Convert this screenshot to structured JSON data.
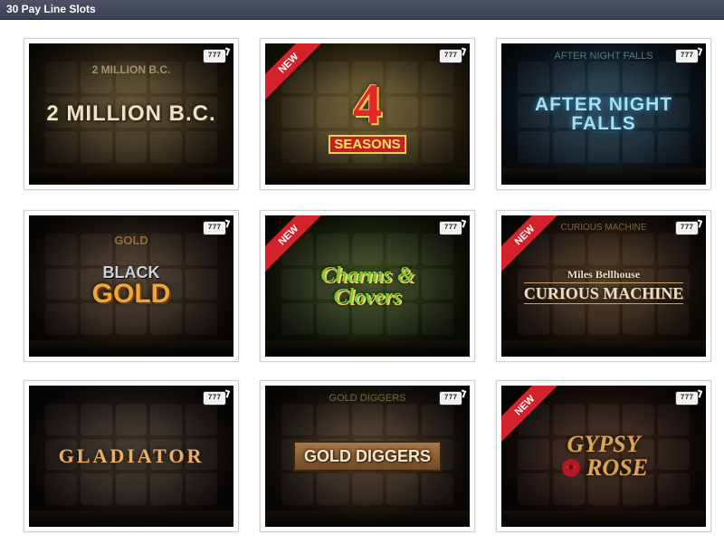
{
  "header": {
    "title": "30 Pay Line Slots"
  },
  "games": [
    {
      "title": "2 MILLION B.C.",
      "top_text": "2 MILLION B.C.",
      "is_new": false,
      "mobile_badge": "777",
      "accent": "#e8dcc0"
    },
    {
      "title": "4",
      "subtitle": "SEASONS",
      "is_new": true,
      "mobile_badge": "777",
      "accent": "#e3262a"
    },
    {
      "title": "AFTER NIGHT FALLS",
      "top_text": "AFTER NIGHT FALLS",
      "is_new": false,
      "mobile_badge": "777",
      "accent": "#9fd6ea"
    },
    {
      "title": "BLACK",
      "subtitle": "GOLD",
      "top_text": "GOLD",
      "is_new": false,
      "mobile_badge": "777",
      "accent": "#f0a632"
    },
    {
      "title": "Charms &",
      "subtitle": "Clovers",
      "is_new": true,
      "mobile_badge": "777",
      "accent": "#6fbf2a"
    },
    {
      "title": "Miles Bellhouse",
      "subtitle": "CURIOUS MACHINE",
      "top_text": "CURIOUS MACHINE",
      "is_new": true,
      "mobile_badge": "777",
      "accent": "#e9dfc3"
    },
    {
      "title": "GLADIATOR",
      "is_new": false,
      "mobile_badge": "777",
      "accent": "#e6b06a"
    },
    {
      "title": "GOLD DIGGERS",
      "top_text": "GOLD DIGGERS",
      "is_new": false,
      "mobile_badge": "777",
      "accent": "#f5e6c8"
    },
    {
      "title": "GYPSY",
      "subtitle": "ROSE",
      "is_new": true,
      "mobile_badge": "777",
      "accent": "#d9a456"
    }
  ],
  "ribbon_label": "NEW"
}
